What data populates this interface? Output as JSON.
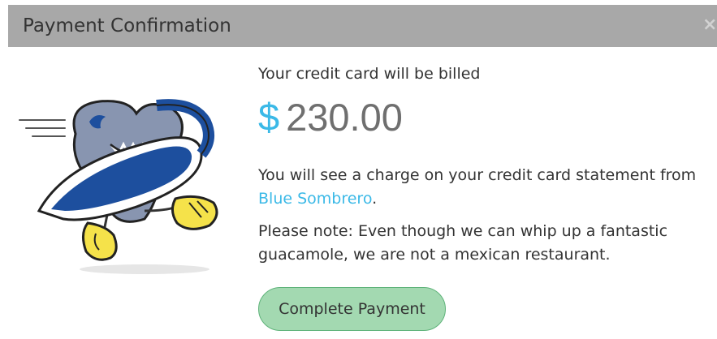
{
  "dialog": {
    "title": "Payment Confirmation",
    "close_label": "×"
  },
  "billing": {
    "intro": "Your credit card will be billed",
    "currency_symbol": "$",
    "amount": "230.00"
  },
  "charge_notice": {
    "prefix": "You will see a charge on your credit card statement from ",
    "merchant": "Blue Sombrero",
    "suffix": "."
  },
  "note": "Please note: Even though we can whip up a fantastic guacamole, we are not a mexican restaurant.",
  "actions": {
    "complete_label": "Complete Payment"
  },
  "colors": {
    "header_bg": "#a8a8a8",
    "accent_blue": "#3bb9e7",
    "amount_gray": "#6f6f6f",
    "button_bg": "#a3d9b1",
    "button_border": "#5fb37a",
    "mascot_blue": "#1d4f9e",
    "mascot_gray": "#8895b0",
    "mascot_yellow": "#f5e24a"
  },
  "icons": {
    "close": "close-icon",
    "mascot": "running-shark-mascot-icon"
  }
}
